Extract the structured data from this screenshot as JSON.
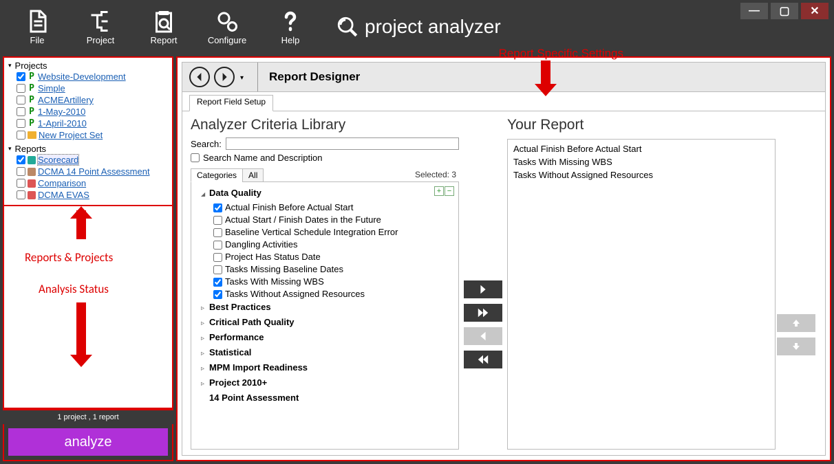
{
  "toolbar": {
    "file": "File",
    "project": "Project",
    "report": "Report",
    "configure": "Configure",
    "help": "Help"
  },
  "brand": "project analyzer",
  "sidebar": {
    "projects_label": "Projects",
    "reports_label": "Reports",
    "projects": [
      {
        "label": "Website-Development",
        "checked": true
      },
      {
        "label": "Simple",
        "checked": false
      },
      {
        "label": "ACMEArtillery",
        "checked": false
      },
      {
        "label": "1-May-2010",
        "checked": false
      },
      {
        "label": "1-April-2010",
        "checked": false
      }
    ],
    "newset": "New Project Set",
    "reports": [
      {
        "label": "Scorecard",
        "checked": true,
        "selected": true
      },
      {
        "label": "DCMA 14 Point Assessment",
        "checked": false
      },
      {
        "label": "Comparison",
        "checked": false
      },
      {
        "label": "DCMA EVAS",
        "checked": false
      }
    ]
  },
  "annotations": {
    "reports_projects": "Reports & Projects",
    "analysis_status": "Analysis Status",
    "report_settings": "Report Specific Settings"
  },
  "status": "1 project , 1 report",
  "analyze": "analyze",
  "designer": {
    "title": "Report Designer",
    "tab": "Report Field Setup",
    "library_title": "Analyzer Criteria Library",
    "search_label": "Search:",
    "search_value": "",
    "search_desc": "Search Name and Description",
    "cat_tab": "Categories",
    "all_tab": "All",
    "selected": "Selected:  3",
    "categories": [
      {
        "name": "Data Quality",
        "open": true,
        "items": [
          {
            "label": "Actual Finish Before Actual Start",
            "checked": true
          },
          {
            "label": "Actual Start / Finish Dates in the Future",
            "checked": false
          },
          {
            "label": "Baseline Vertical Schedule Integration Error",
            "checked": false
          },
          {
            "label": "Dangling Activities",
            "checked": false
          },
          {
            "label": "Project Has Status Date",
            "checked": false
          },
          {
            "label": "Tasks Missing Baseline Dates",
            "checked": false
          },
          {
            "label": "Tasks With Missing WBS",
            "checked": true
          },
          {
            "label": "Tasks Without Assigned Resources",
            "checked": true
          }
        ]
      },
      {
        "name": "Best Practices",
        "open": false
      },
      {
        "name": "Critical Path Quality",
        "open": false
      },
      {
        "name": "Performance",
        "open": false
      },
      {
        "name": "Statistical",
        "open": false
      },
      {
        "name": "MPM Import Readiness",
        "open": false
      },
      {
        "name": "Project 2010+",
        "open": false
      },
      {
        "name": "14 Point Assessment",
        "open": false,
        "noarrow": true
      }
    ],
    "your_report_title": "Your Report",
    "your_report": [
      "Actual Finish Before Actual Start",
      "Tasks With Missing WBS",
      "Tasks Without Assigned Resources"
    ]
  }
}
